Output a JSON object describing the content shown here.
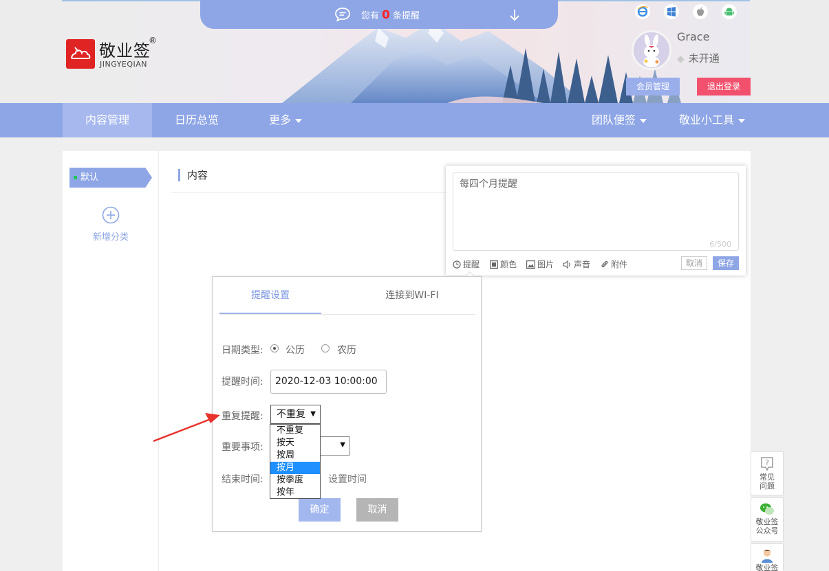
{
  "notice": {
    "prefix": "您有",
    "count": "0",
    "suffix": "条提醒"
  },
  "logo": {
    "cn": "敬业签",
    "reg": "®",
    "en": "JINGYEQIAN"
  },
  "platforms": [
    "ie-icon",
    "windows-icon",
    "apple-icon",
    "android-icon"
  ],
  "user": {
    "name": "Grace",
    "status": "未开通",
    "member_btn": "会员管理",
    "logout_btn": "退出登录"
  },
  "nav": {
    "items": [
      "内容管理",
      "日历总览",
      "更多"
    ],
    "right": [
      "团队便签",
      "敬业小工具"
    ]
  },
  "sidebar": {
    "default_cat": "默认",
    "add_cat": "新增分类"
  },
  "content": {
    "title": "内容"
  },
  "editor": {
    "text": "每四个月提醒",
    "count": "6/500",
    "tools": [
      "提醒",
      "颜色",
      "图片",
      "声音",
      "附件"
    ],
    "cancel": "取消",
    "save": "保存"
  },
  "reminder": {
    "tabs": [
      "提醒设置",
      "连接到WI-FI"
    ],
    "date_type_label": "日期类型:",
    "date_options": [
      "公历",
      "农历"
    ],
    "time_label": "提醒时间:",
    "time_value": "2020-12-03 10:00:00",
    "repeat_label": "重复提醒:",
    "repeat_value": "不重复",
    "repeat_options": [
      "不重复",
      "按天",
      "按周",
      "按月",
      "按季度",
      "按年"
    ],
    "repeat_highlighted": "按月",
    "important_label": "重要事项:",
    "end_label": "结束时间:",
    "end_link": "设置时间",
    "confirm": "确定",
    "cancel": "取消"
  },
  "float": {
    "faq": [
      "常见",
      "问题"
    ],
    "wechat": [
      "敬业签",
      "公众号"
    ],
    "service": "敬业签"
  },
  "colors": {
    "primary": "#8ea6e6",
    "logout": "#f2516e",
    "logo": "#e02424",
    "highlight": "#1e90ff"
  }
}
